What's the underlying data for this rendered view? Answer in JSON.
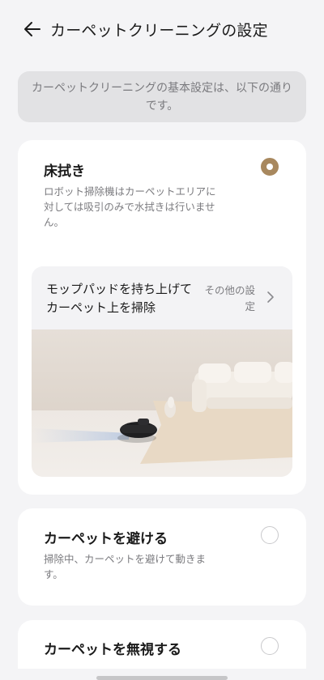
{
  "header": {
    "title": "カーペットクリーニングの設定",
    "back_icon": "arrow-left-icon"
  },
  "info_banner": {
    "text": "カーペットクリーニングの基本設定は、以下の通りです。"
  },
  "options": [
    {
      "title": "床拭き",
      "description": "ロボット掃除機はカーペットエリアに対しては吸引のみで水拭きは行いません。",
      "selected": true
    },
    {
      "title": "カーペットを避ける",
      "description": "掃除中、カーペットを避けて動きます。",
      "selected": false
    },
    {
      "title": "カーペットを無視する",
      "selected": false
    }
  ],
  "mop_setting": {
    "label": "モップパッドを持ち上げてカーペット上を掃除",
    "other_settings": "その他の設定",
    "chevron_icon": "chevron-right-icon"
  },
  "colors": {
    "accent": "#a8885e",
    "background": "#f4f4f6",
    "card": "#ffffff"
  }
}
